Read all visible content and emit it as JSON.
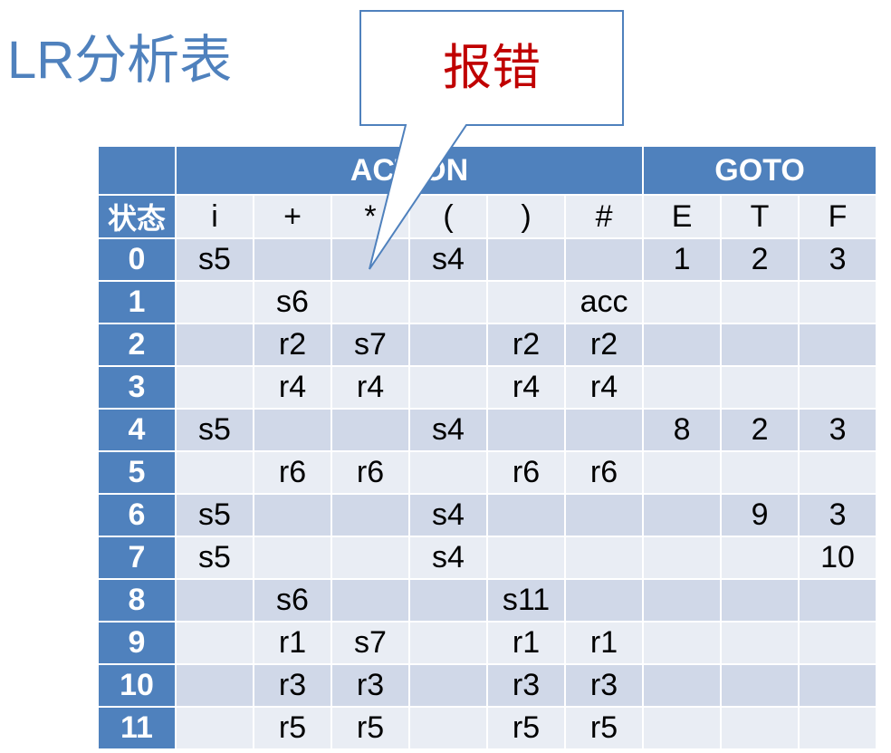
{
  "title": "LR分析表",
  "callout": {
    "text": "报错",
    "colors": {
      "border": "#4f81bd",
      "fill": "#ffffff",
      "text": "#c00000"
    }
  },
  "colors": {
    "header": "#4f81bd",
    "row_odd": "#d0d8e8",
    "row_even": "#e9edf4",
    "title": "#4f81bd"
  },
  "table": {
    "action_label": "ACTION",
    "goto_label": "GOTO",
    "state_label": "状态",
    "symbols": [
      "i",
      "+",
      "*",
      "(",
      ")",
      "#",
      "E",
      "T",
      "F"
    ],
    "rows": [
      {
        "state": "0",
        "cells": [
          "s5",
          "",
          "",
          "s4",
          "",
          "",
          "1",
          "2",
          "3"
        ]
      },
      {
        "state": "1",
        "cells": [
          "",
          "s6",
          "",
          "",
          "",
          "acc",
          "",
          "",
          ""
        ]
      },
      {
        "state": "2",
        "cells": [
          "",
          "r2",
          "s7",
          "",
          "r2",
          "r2",
          "",
          "",
          ""
        ]
      },
      {
        "state": "3",
        "cells": [
          "",
          "r4",
          "r4",
          "",
          "r4",
          "r4",
          "",
          "",
          ""
        ]
      },
      {
        "state": "4",
        "cells": [
          "s5",
          "",
          "",
          "s4",
          "",
          "",
          "8",
          "2",
          "3"
        ]
      },
      {
        "state": "5",
        "cells": [
          "",
          "r6",
          "r6",
          "",
          "r6",
          "r6",
          "",
          "",
          ""
        ]
      },
      {
        "state": "6",
        "cells": [
          "s5",
          "",
          "",
          "s4",
          "",
          "",
          "",
          "9",
          "3"
        ]
      },
      {
        "state": "7",
        "cells": [
          "s5",
          "",
          "",
          "s4",
          "",
          "",
          "",
          "",
          "10"
        ]
      },
      {
        "state": "8",
        "cells": [
          "",
          "s6",
          "",
          "",
          "s11",
          "",
          "",
          "",
          ""
        ]
      },
      {
        "state": "9",
        "cells": [
          "",
          "r1",
          "s7",
          "",
          "r1",
          "r1",
          "",
          "",
          ""
        ]
      },
      {
        "state": "10",
        "cells": [
          "",
          "r3",
          "r3",
          "",
          "r3",
          "r3",
          "",
          "",
          ""
        ]
      },
      {
        "state": "11",
        "cells": [
          "",
          "r5",
          "r5",
          "",
          "r5",
          "r5",
          "",
          "",
          ""
        ]
      }
    ]
  }
}
